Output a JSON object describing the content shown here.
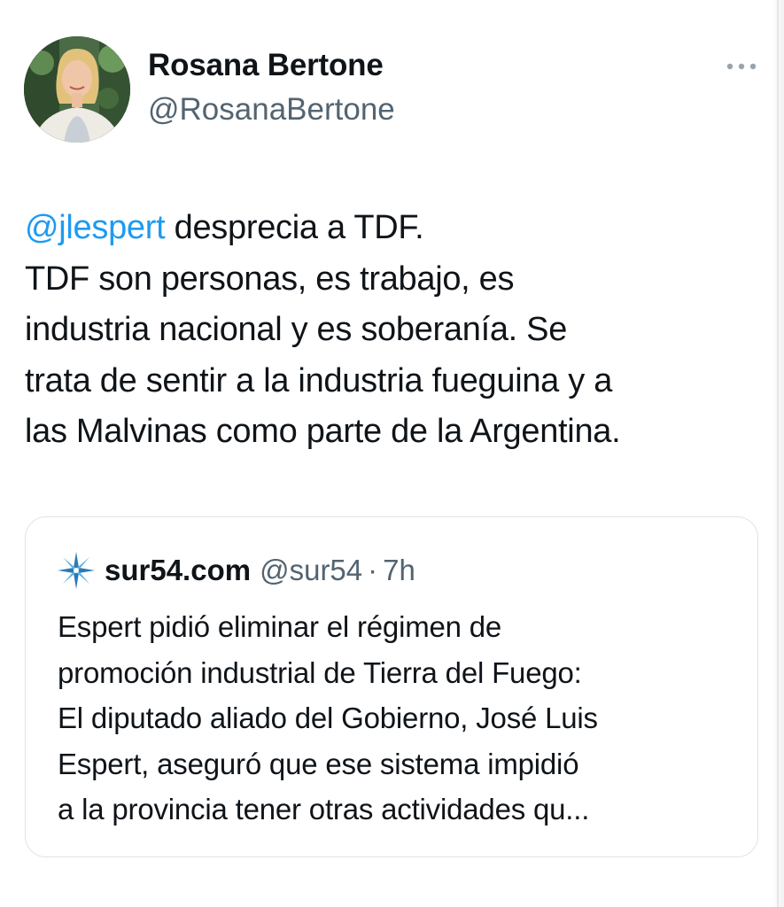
{
  "author": {
    "display_name": "Rosana Bertone",
    "handle": "@RosanaBertone",
    "avatar_icon": "profile-photo"
  },
  "more_icon": "more-horizontal-icon",
  "tweet": {
    "mention": "@jlespert",
    "lines": [
      " desprecia a TDF.",
      "TDF son personas, es trabajo, es",
      "industria nacional y es soberanía. Se",
      "trata de sentir a la industria fueguina y a",
      "las Malvinas como parte de la Argentina."
    ]
  },
  "quoted": {
    "logo_icon": "compass-star-icon",
    "name": "sur54.com",
    "handle": "@sur54",
    "separator": "·",
    "time": "7h",
    "lines": [
      "Espert pidió eliminar el régimen de",
      "promoción industrial de Tierra del Fuego:",
      "El diputado aliado del Gobierno, José Luis",
      "Espert, aseguró que ese sistema impidió",
      "a la provincia tener otras actividades qu..."
    ]
  },
  "colors": {
    "text": "#0f1419",
    "secondary": "#536471",
    "mention": "#1d9bf0",
    "border": "#dfe3e7"
  }
}
